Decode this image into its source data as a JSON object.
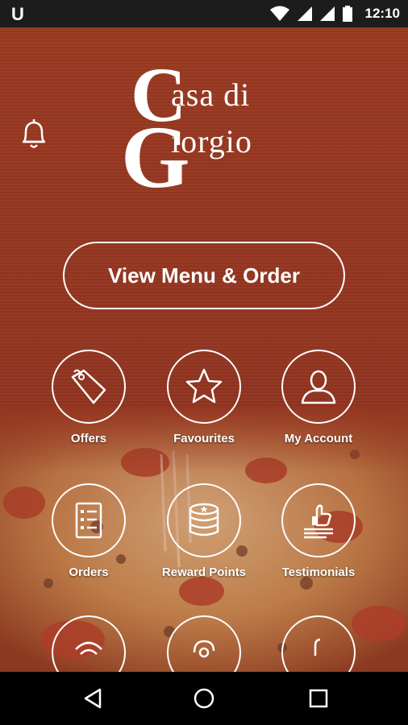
{
  "status_bar": {
    "app_glyph": "U",
    "time": "12:10",
    "icons": [
      "wifi-icon",
      "signal-icon",
      "signal-icon",
      "battery-icon"
    ]
  },
  "logo": {
    "big_c": "C",
    "line1": "asa di",
    "big_g": "G",
    "line2": "iorgio"
  },
  "cta": {
    "label": "View Menu & Order"
  },
  "tiles": [
    {
      "label": "Offers",
      "icon": "price-tag-icon"
    },
    {
      "label": "Favourites",
      "icon": "star-icon"
    },
    {
      "label": "My Account",
      "icon": "user-icon"
    },
    {
      "label": "Orders",
      "icon": "checklist-icon"
    },
    {
      "label": "Reward Points",
      "icon": "coin-stack-icon"
    },
    {
      "label": "Testimonials",
      "icon": "thumbs-up-icon"
    }
  ],
  "partial_tiles": [
    "wifi-icon",
    "at-sign-icon",
    "phone-icon"
  ],
  "nav": [
    "back-icon",
    "home-icon",
    "recents-icon"
  ],
  "colors": {
    "background": "#943621",
    "foreground": "#ffffff"
  }
}
